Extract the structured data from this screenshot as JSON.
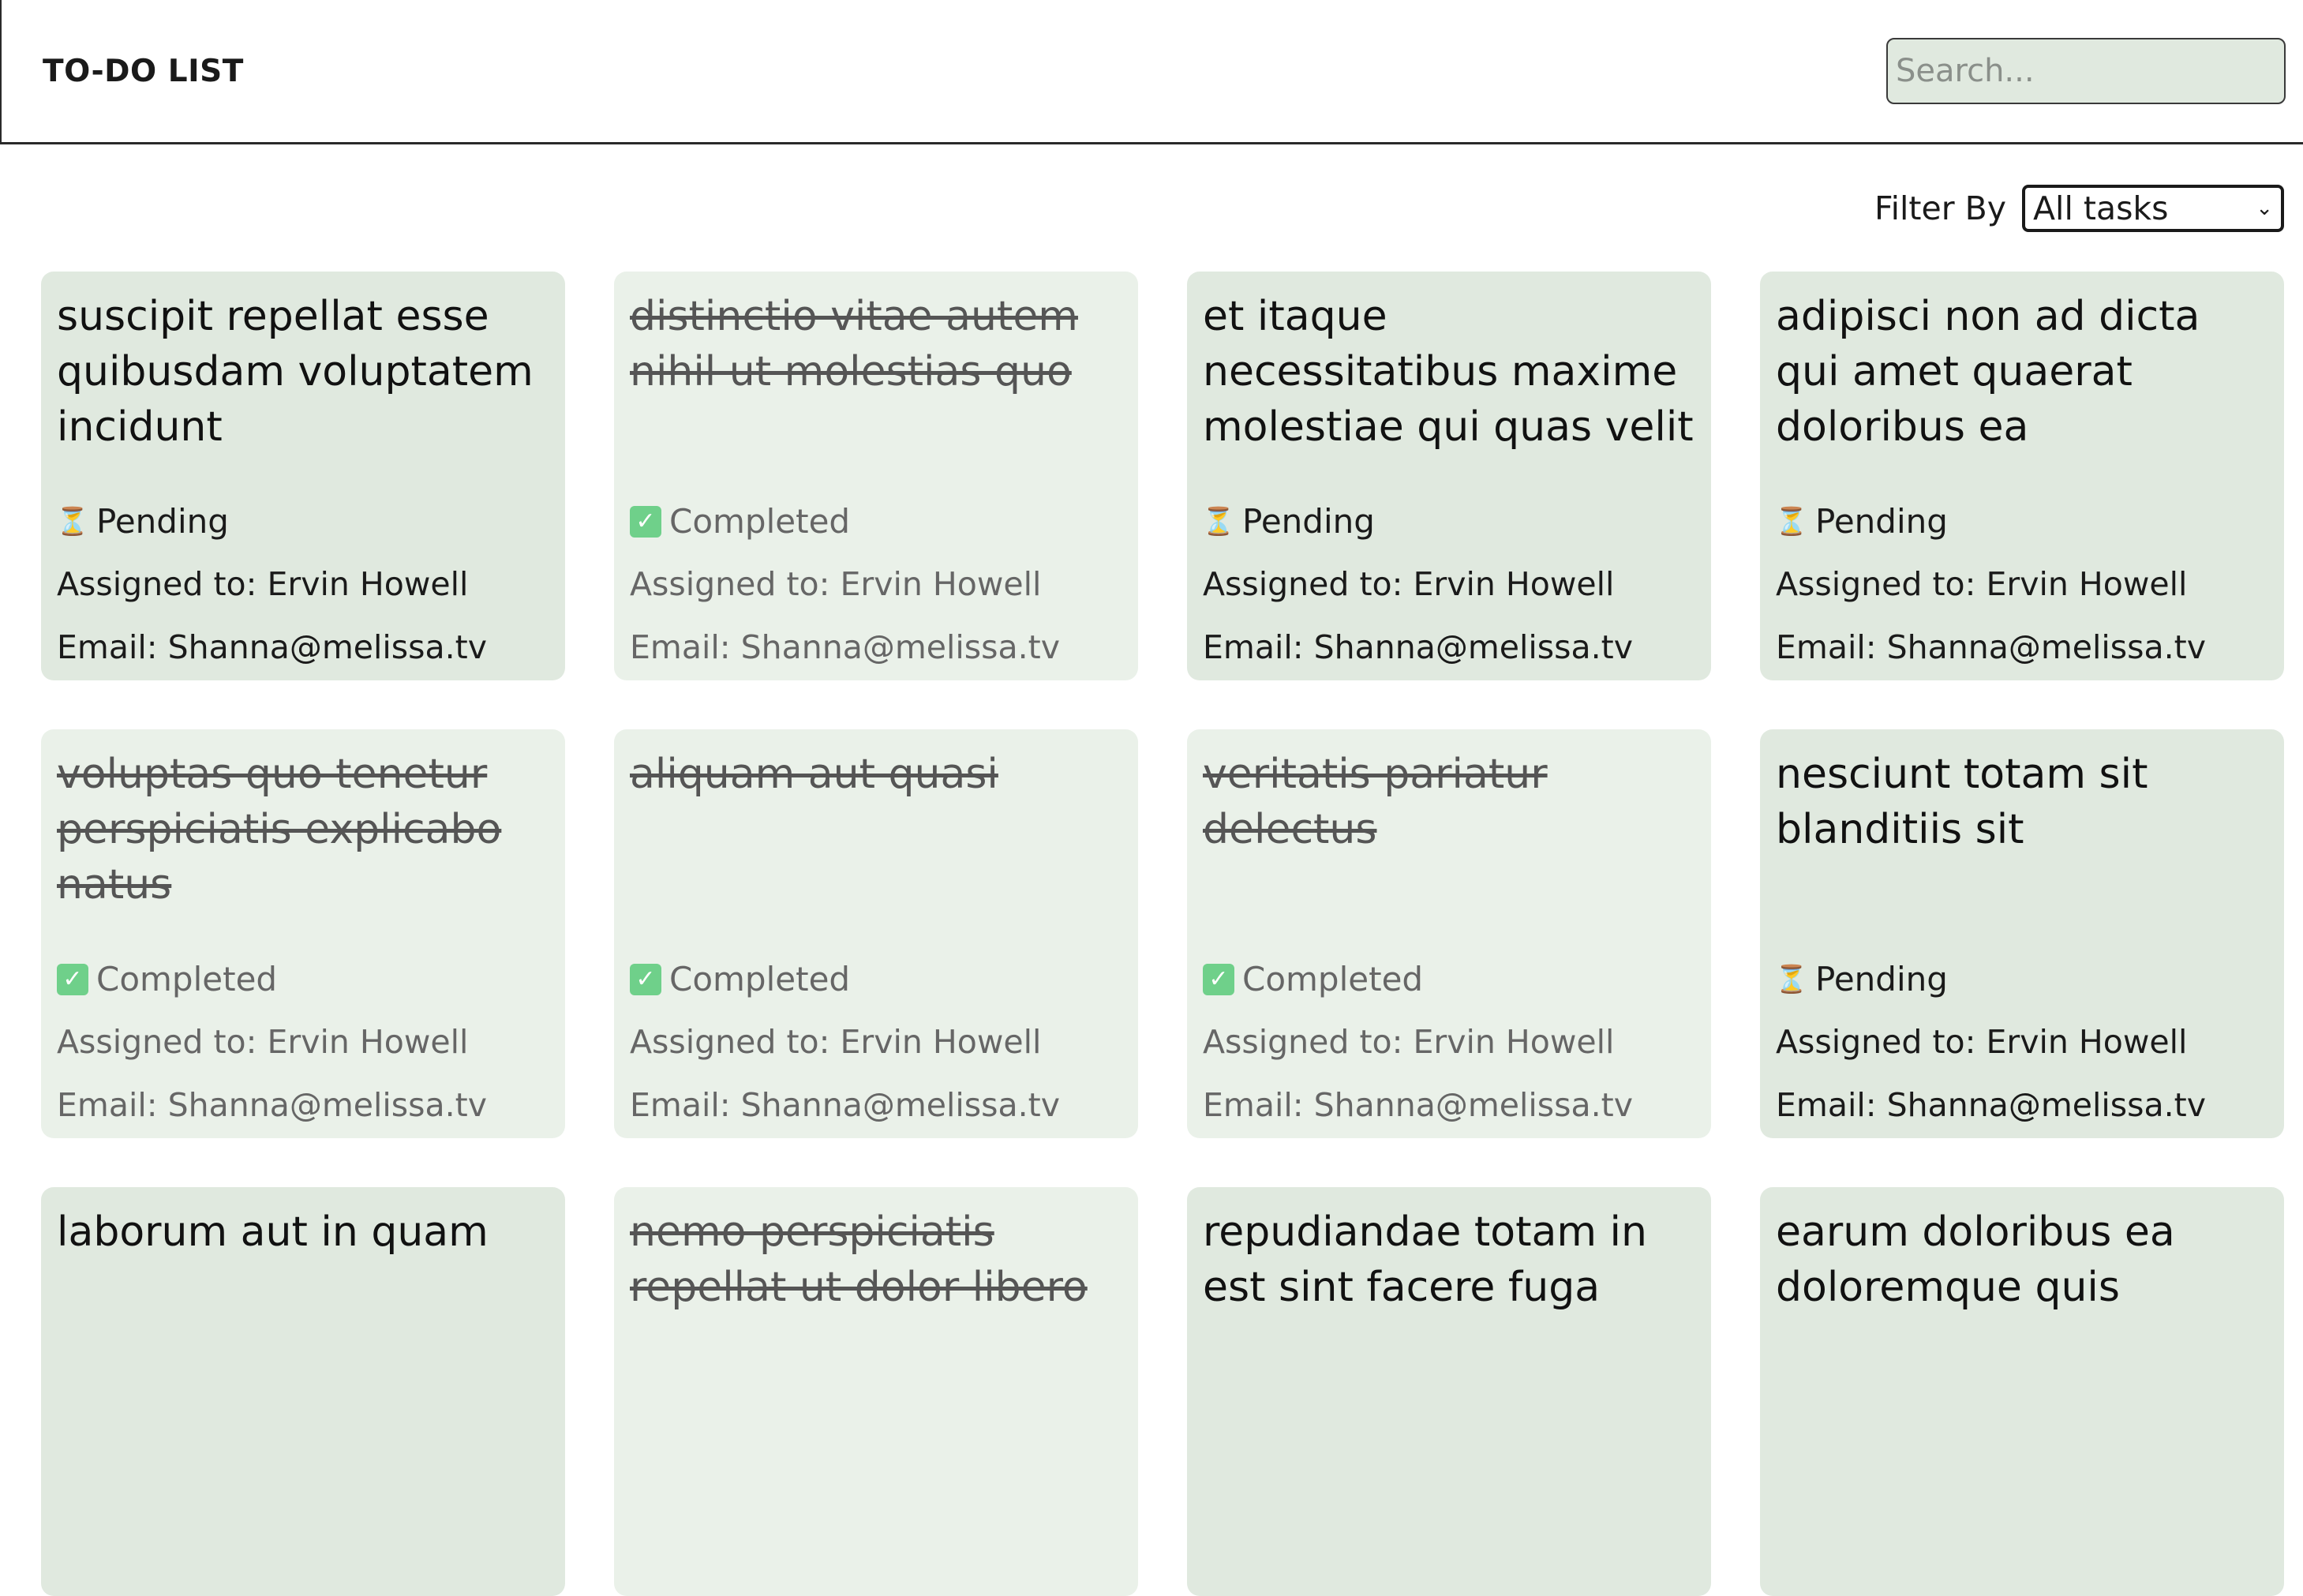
{
  "header": {
    "title": "TO-DO LIST",
    "search_placeholder": "Search..."
  },
  "filter": {
    "label": "Filter By",
    "selected": "All tasks"
  },
  "labels": {
    "assigned_prefix": "Assigned to:",
    "email_prefix": "Email:"
  },
  "tasks": [
    {
      "title": "suscipit repellat esse quibusdam voluptatem incidunt",
      "status": "Pending",
      "completed": false,
      "assignee": "Ervin Howell",
      "email": "Shanna@melissa.tv"
    },
    {
      "title": "distinctio vitae autem nihil ut molestias quo",
      "status": "Completed",
      "completed": true,
      "assignee": "Ervin Howell",
      "email": "Shanna@melissa.tv"
    },
    {
      "title": "et itaque necessitatibus maxime molestiae qui quas velit",
      "status": "Pending",
      "completed": false,
      "assignee": "Ervin Howell",
      "email": "Shanna@melissa.tv"
    },
    {
      "title": "adipisci non ad dicta qui amet quaerat doloribus ea",
      "status": "Pending",
      "completed": false,
      "assignee": "Ervin Howell",
      "email": "Shanna@melissa.tv"
    },
    {
      "title": "voluptas quo tenetur perspiciatis explicabo natus",
      "status": "Completed",
      "completed": true,
      "assignee": "Ervin Howell",
      "email": "Shanna@melissa.tv"
    },
    {
      "title": "aliquam aut quasi",
      "status": "Completed",
      "completed": true,
      "assignee": "Ervin Howell",
      "email": "Shanna@melissa.tv"
    },
    {
      "title": "veritatis pariatur delectus",
      "status": "Completed",
      "completed": true,
      "assignee": "Ervin Howell",
      "email": "Shanna@melissa.tv"
    },
    {
      "title": "nesciunt totam sit blanditiis sit",
      "status": "Pending",
      "completed": false,
      "assignee": "Ervin Howell",
      "email": "Shanna@melissa.tv"
    },
    {
      "title": "laborum aut in quam",
      "status": "",
      "completed": false,
      "assignee": "",
      "email": ""
    },
    {
      "title": "nemo perspiciatis repellat ut dolor libero",
      "status": "",
      "completed": true,
      "assignee": "",
      "email": ""
    },
    {
      "title": "repudiandae totam in est sint facere fuga",
      "status": "",
      "completed": false,
      "assignee": "",
      "email": ""
    },
    {
      "title": "earum doloribus ea doloremque quis",
      "status": "",
      "completed": false,
      "assignee": "",
      "email": ""
    }
  ]
}
